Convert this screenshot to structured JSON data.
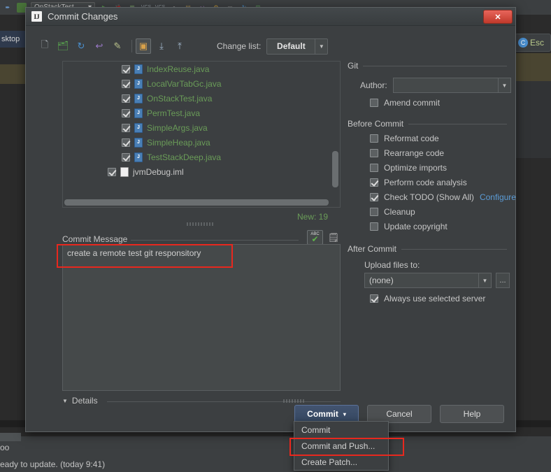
{
  "background": {
    "toolbar": {
      "combo_value": "OnStackTest",
      "icons": [
        "back-arrow-icon",
        "build-icon",
        "run-icon",
        "debug-icon",
        "coverage-icon",
        "vcs-update-icon",
        "vcs-commit-icon",
        "search-icon",
        "structure-icon",
        "undo-icon",
        "settings-icon",
        "layout-icon",
        "refresh-icon",
        "plugin-icon"
      ]
    },
    "left_panel": {
      "gear_label": "",
      "tab_label": "sktop"
    },
    "right_panel": {
      "esc_label": "Esc"
    },
    "status": {
      "line1": "oo",
      "line2": "eady to update. (today 9:41)"
    }
  },
  "dialog": {
    "title": "Commit Changes",
    "logo": "IJ",
    "close_label": "✕",
    "toolbar": {
      "icons": [
        "show-diff-icon",
        "move-to-changelist-icon",
        "refresh-icon",
        "revert-icon",
        "edit-source-icon",
        "group-by-directory-icon",
        "expand-all-icon",
        "collapse-all-icon"
      ],
      "changelist_label": "Change list:",
      "changelist_value": "Default"
    },
    "files": [
      {
        "name": "IndexReuse.java",
        "checked": true,
        "type": "java",
        "level": "child"
      },
      {
        "name": "LocalVarTabGc.java",
        "checked": true,
        "type": "java",
        "level": "child"
      },
      {
        "name": "OnStackTest.java",
        "checked": true,
        "type": "java",
        "level": "child"
      },
      {
        "name": "PermTest.java",
        "checked": true,
        "type": "java",
        "level": "child"
      },
      {
        "name": "SimpleArgs.java",
        "checked": true,
        "type": "java",
        "level": "child"
      },
      {
        "name": "SimpleHeap.java",
        "checked": true,
        "type": "java",
        "level": "child"
      },
      {
        "name": "TestStackDeep.java",
        "checked": true,
        "type": "java",
        "level": "child"
      },
      {
        "name": "jvmDebug.iml",
        "checked": true,
        "type": "iml",
        "level": "root"
      }
    ],
    "new_count": "New: 19",
    "commit_message": {
      "label": "Commit Message",
      "value": "create a remote test git responsitory",
      "spellcheck_icon_text": "ABC",
      "history_icon": "history-icon"
    },
    "details_label": "Details",
    "git_group": {
      "title": "Git",
      "author_label": "Author:",
      "author_value": "",
      "amend_label": "Amend commit",
      "amend_checked": false
    },
    "before_commit_group": {
      "title": "Before Commit",
      "items": [
        {
          "label": "Reformat code",
          "checked": false
        },
        {
          "label": "Rearrange code",
          "checked": false
        },
        {
          "label": "Optimize imports",
          "checked": false
        },
        {
          "label": "Perform code analysis",
          "checked": true
        },
        {
          "label": "Check TODO (Show All)",
          "checked": true,
          "link": "Configure"
        },
        {
          "label": "Cleanup",
          "checked": false
        },
        {
          "label": "Update copyright",
          "checked": false
        }
      ]
    },
    "after_commit_group": {
      "title": "After Commit",
      "upload_label": "Upload files to:",
      "upload_value": "(none)",
      "ellipsis_label": "...",
      "always_label": "Always use selected server",
      "always_checked": true
    },
    "buttons": {
      "commit": "Commit",
      "commit_caret": "▾",
      "cancel": "Cancel",
      "help": "Help"
    },
    "dropdown": {
      "items": [
        "Commit",
        "Commit and Push...",
        "Create Patch..."
      ],
      "highlighted_index": 1
    }
  },
  "colors": {
    "dialog_bg": "#3c3f41",
    "accent_primary": "#3d5069",
    "file_green": "#6a9c58",
    "link_blue": "#5b9bd5",
    "highlight_red": "#e8281e",
    "close_red": "#c0392b"
  }
}
